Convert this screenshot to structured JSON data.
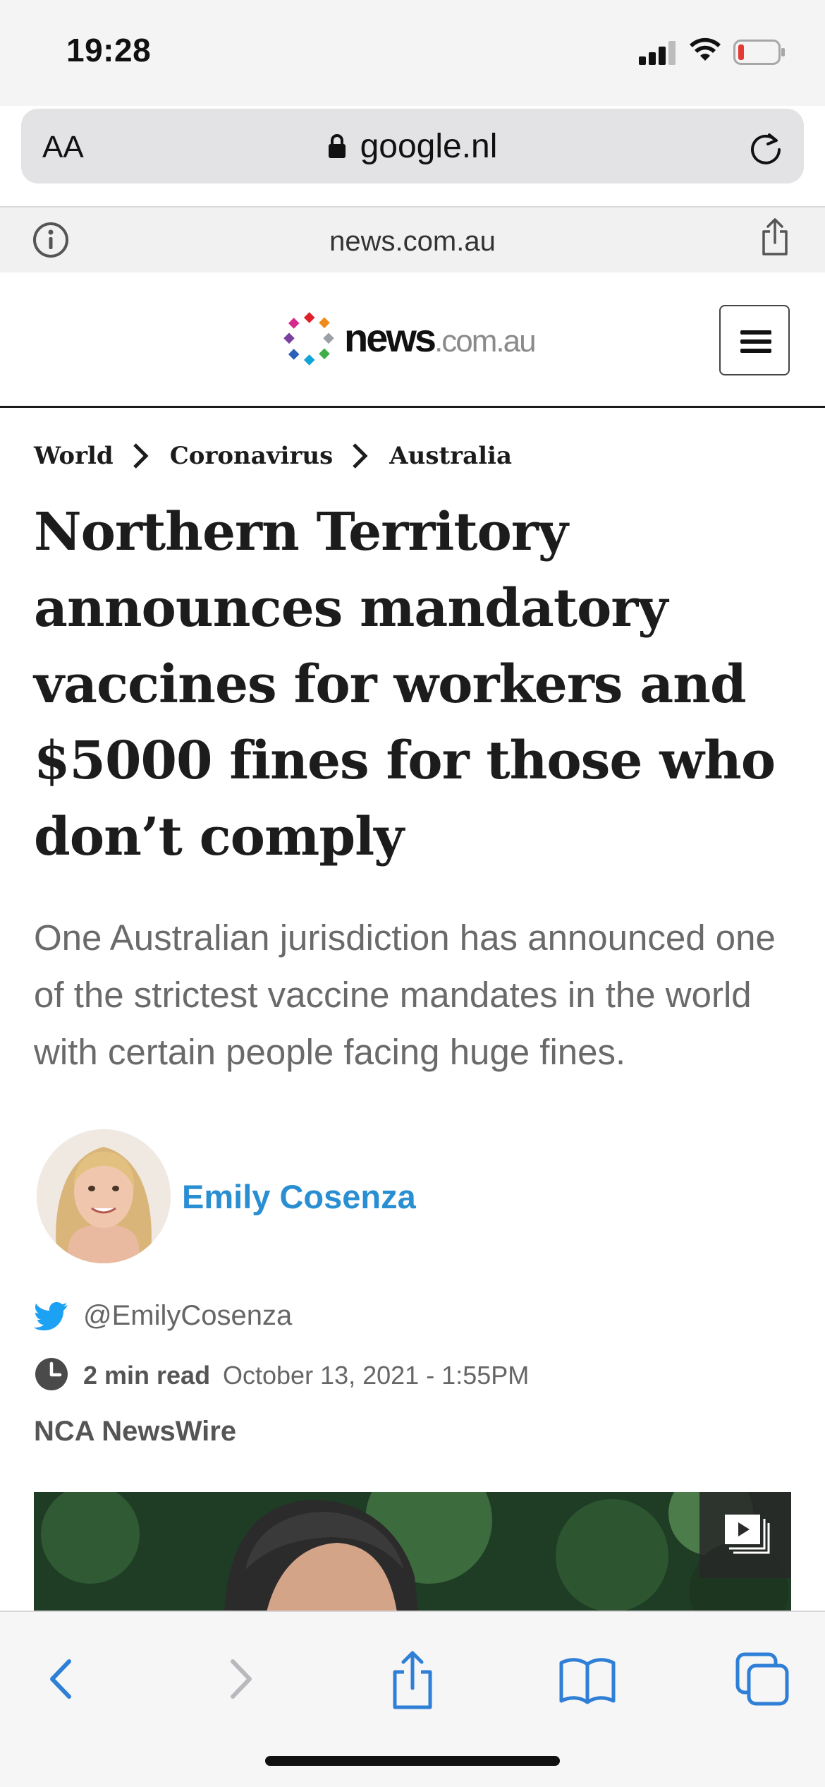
{
  "status_bar": {
    "time": "19:28"
  },
  "address_bar": {
    "text_size_label": "AA",
    "url": "google.nl"
  },
  "info_bar": {
    "domain": "news.com.au"
  },
  "site": {
    "logo_main": "news",
    "logo_tld": ".com.au"
  },
  "breadcrumb": [
    "World",
    "Coronavirus",
    "Australia"
  ],
  "article": {
    "headline": "Northern Territory announces mandatory vaccines for workers and $5000 fines for those who don’t comply",
    "standfirst": "One Australian jurisdiction has announced one of the strictest vaccine mandates in the world with certain people facing huge fines.",
    "author": "Emily Cosenza",
    "twitter_handle": "@EmilyCosenza",
    "read_time": "2 min read",
    "published": "October 13, 2021 - 1:55PM",
    "source": "NCA NewsWire"
  },
  "colors": {
    "accent_link": "#2a8fd2",
    "safari_blue": "#2f7fd6",
    "battery_low": "#e53935",
    "twitter": "#1da1f2"
  },
  "icons": [
    "lock-icon",
    "reload-icon",
    "info-icon",
    "share-icon",
    "menu-icon",
    "chevron-right-icon",
    "twitter-icon",
    "clock-icon",
    "video-icon",
    "back-icon",
    "forward-icon",
    "bookmarks-icon",
    "tabs-icon"
  ]
}
